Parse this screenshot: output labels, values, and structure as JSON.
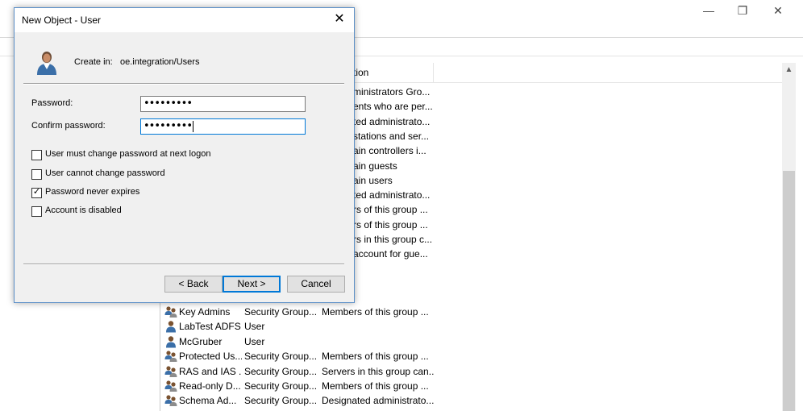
{
  "dialog": {
    "title": "New Object - User",
    "create_in_label": "Create in:",
    "create_in_path": "oe.integration/Users",
    "password_label": "Password:",
    "password_value": "•••••••••",
    "confirm_label": "Confirm password:",
    "confirm_value": "•••••••••",
    "checkboxes": [
      {
        "label": "User must change password at next logon",
        "checked": false
      },
      {
        "label": "User cannot change password",
        "checked": false
      },
      {
        "label": "Password never expires",
        "checked": true
      },
      {
        "label": "Account is disabled",
        "checked": false
      }
    ],
    "back_label": "< Back",
    "next_label": "Next >",
    "cancel_label": "Cancel"
  },
  "window": {
    "minimize": "—",
    "restore": "❐",
    "close": "✕"
  },
  "list": {
    "header_desc": "tion",
    "partial_desc_rows": [
      "ministrators Gro...",
      "ents who are per...",
      "ted administrato...",
      "stations and ser...",
      "ain controllers i...",
      "ain guests",
      "ain users",
      "ted administrato...",
      "rs of this group ...",
      "rs of this group ...",
      "rs in this group c...",
      "account for gue..."
    ],
    "rows": [
      {
        "icon": "group-icon",
        "name": "Key Admins",
        "type": "Security Group...",
        "desc": "Members of this group ..."
      },
      {
        "icon": "user-icon",
        "name": "LabTest ADFS",
        "type": "User",
        "desc": ""
      },
      {
        "icon": "user-icon",
        "name": "McGruber",
        "type": "User",
        "desc": ""
      },
      {
        "icon": "group-icon",
        "name": "Protected Us...",
        "type": "Security Group...",
        "desc": "Members of this group ..."
      },
      {
        "icon": "group-icon",
        "name": "RAS and IAS ...",
        "type": "Security Group...",
        "desc": "Servers in this group can..."
      },
      {
        "icon": "group-icon",
        "name": "Read-only D...",
        "type": "Security Group...",
        "desc": "Members of this group ..."
      },
      {
        "icon": "group-icon",
        "name": "Schema Ad...",
        "type": "Security Group...",
        "desc": "Designated administrato..."
      }
    ]
  },
  "scrollbar": {
    "up_arrow": "▲"
  }
}
